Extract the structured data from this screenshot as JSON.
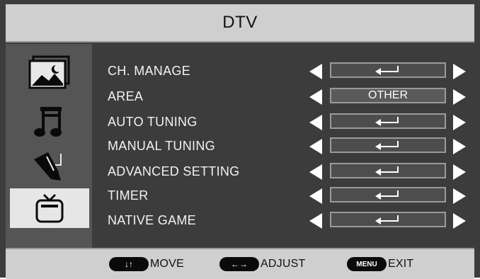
{
  "header": {
    "title": "DTV"
  },
  "sidebar": {
    "items": [
      {
        "icon": "picture-icon",
        "selected": false
      },
      {
        "icon": "music-note-icon",
        "selected": false
      },
      {
        "icon": "pen-tool-icon",
        "selected": false
      },
      {
        "icon": "tv-icon",
        "selected": true
      }
    ]
  },
  "menu": {
    "items": [
      {
        "label": "CH. MANAGE",
        "value": "",
        "value_icon": "enter-icon"
      },
      {
        "label": "AREA",
        "value": "OTHER",
        "value_icon": ""
      },
      {
        "label": "AUTO TUNING",
        "value": "",
        "value_icon": "enter-icon"
      },
      {
        "label": "MANUAL TUNING",
        "value": "",
        "value_icon": "enter-icon"
      },
      {
        "label": "ADVANCED SETTING",
        "value": "",
        "value_icon": "enter-icon"
      },
      {
        "label": "TIMER",
        "value": "",
        "value_icon": "enter-icon"
      },
      {
        "label": "NATIVE GAME",
        "value": "",
        "value_icon": "enter-icon"
      }
    ]
  },
  "footer": {
    "move": {
      "key": "↓↑",
      "label": "MOVE"
    },
    "adjust": {
      "key": "←→",
      "label": "ADJUST"
    },
    "exit": {
      "key": "MENU",
      "label": "EXIT"
    }
  },
  "colors": {
    "panel_bg": "#3c3c3c",
    "bar_bg": "#cfcfcf",
    "selected_bg": "#e6e6e6",
    "text_light": "#f2f2f2"
  }
}
